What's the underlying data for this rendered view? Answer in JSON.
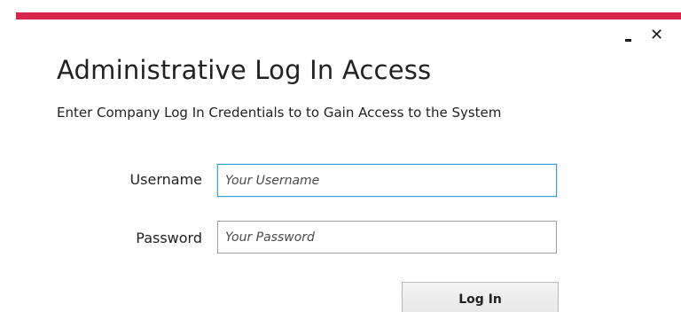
{
  "window": {
    "accent_color": "#d6274a",
    "minimize_icon": "minimize-icon",
    "close_icon": "close-icon",
    "close_glyph": "✕"
  },
  "header": {
    "title": "Administrative Log In Access",
    "subtitle": "Enter Company Log In Credentials to to Gain Access to the System"
  },
  "form": {
    "username": {
      "label": "Username",
      "value": "",
      "placeholder": "Your Username"
    },
    "password": {
      "label": "Password",
      "value": "",
      "placeholder": "Your Password"
    },
    "submit_label": "Log In"
  }
}
